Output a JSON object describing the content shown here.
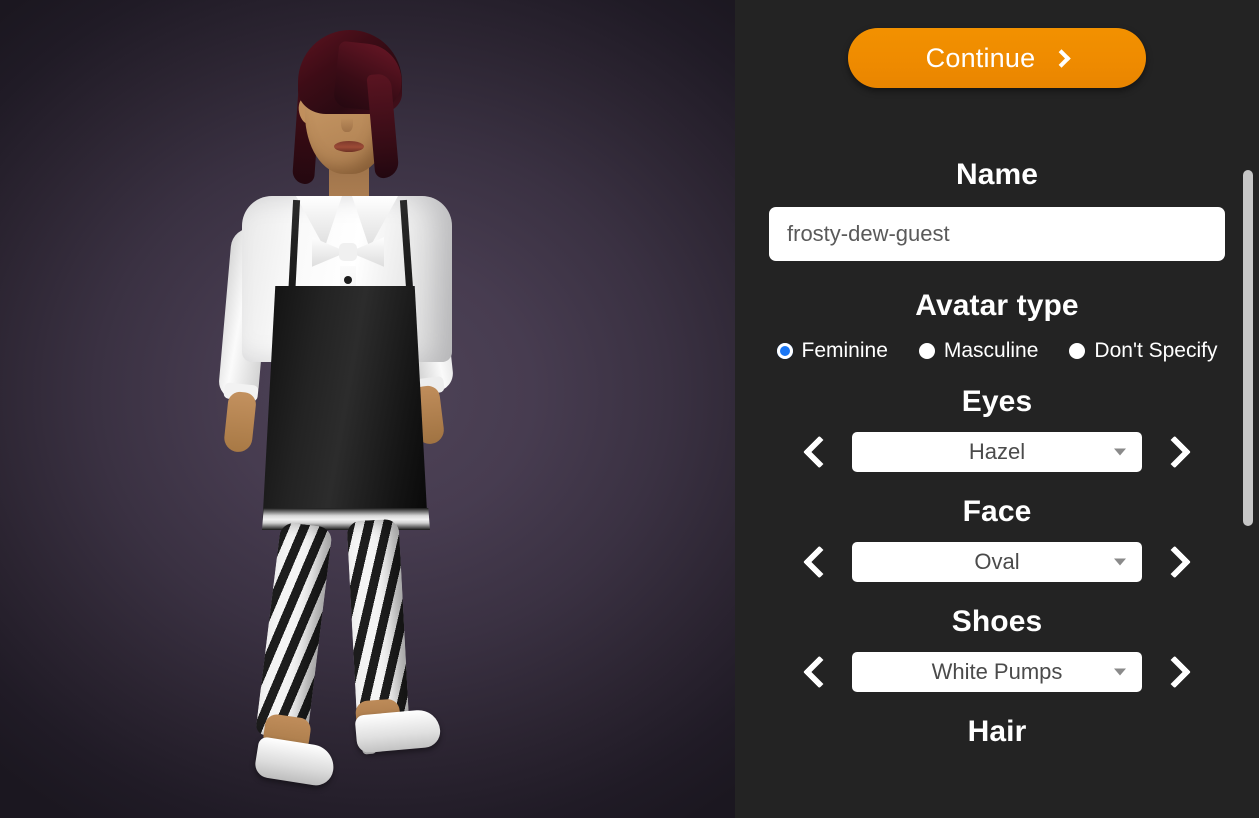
{
  "continue_button": {
    "label": "Continue",
    "icon": "chevron-right-icon",
    "color": "#ef8b00"
  },
  "name": {
    "heading": "Name",
    "value": "frosty-dew-guest",
    "placeholder": "frosty-dew-guest"
  },
  "avatar_type": {
    "heading": "Avatar type",
    "options": [
      {
        "label": "Feminine",
        "selected": true
      },
      {
        "label": "Masculine",
        "selected": false
      },
      {
        "label": "Don't Specify",
        "selected": false
      }
    ],
    "selected_color": "#1976f5"
  },
  "option_groups": [
    {
      "heading": "Eyes",
      "value": "Hazel",
      "prev_icon": "chevron-left-icon",
      "next_icon": "chevron-right-icon",
      "caret_icon": "caret-down-icon"
    },
    {
      "heading": "Face",
      "value": "Oval",
      "prev_icon": "chevron-left-icon",
      "next_icon": "chevron-right-icon",
      "caret_icon": "caret-down-icon"
    },
    {
      "heading": "Shoes",
      "value": "White Pumps",
      "prev_icon": "chevron-left-icon",
      "next_icon": "chevron-right-icon",
      "caret_icon": "caret-down-icon"
    }
  ],
  "partial_group": {
    "heading": "Hair"
  },
  "scrollbar": {
    "orientation": "vertical",
    "thumb_color": "#c6c6c6"
  },
  "panel": {
    "background": "#232323"
  },
  "avatar_preview": {
    "background_center": "#4e4357",
    "background_edge": "#1b1720",
    "hair_color": "#3d0c16",
    "skin_color": "#c0915f",
    "top_color": "#ffffff",
    "dress_color": "#141414",
    "shoes_color": "#ffffff"
  }
}
